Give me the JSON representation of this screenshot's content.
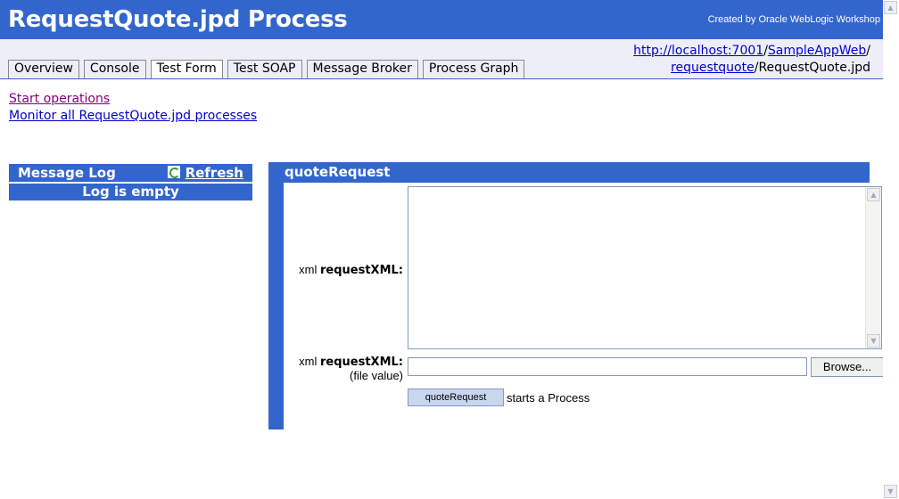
{
  "header": {
    "title": "RequestQuote.jpd Process",
    "created_by": "Created by Oracle WebLogic Workshop"
  },
  "tabs": [
    {
      "label": "Overview",
      "active": false
    },
    {
      "label": "Console",
      "active": false
    },
    {
      "label": "Test Form",
      "active": true
    },
    {
      "label": "Test SOAP",
      "active": false
    },
    {
      "label": "Message Broker",
      "active": false
    },
    {
      "label": "Process Graph",
      "active": false
    }
  ],
  "url": {
    "part1": "http://localhost:7001",
    "sep1": "/",
    "part2": "SampleAppWeb",
    "sep2": "/",
    "part3": "requestquote",
    "sep3": "/RequestQuote.jpd"
  },
  "links": {
    "start": "Start operations",
    "monitor": "Monitor all RequestQuote.jpd processes"
  },
  "message_log": {
    "title": "Message Log",
    "refresh": "Refresh",
    "empty": "Log is empty"
  },
  "operation": {
    "name": "quoteRequest",
    "field1_type": "xml",
    "field1_name": "requestXML:",
    "field1_value": "",
    "field2_type": "xml",
    "field2_name": "requestXML:",
    "field2_note": "(file value)",
    "browse_label": "Browse...",
    "submit_label": "quoteRequest",
    "submit_note": "starts a Process"
  },
  "colors": {
    "brand": "#3366cc",
    "tabbar_bg": "#eeeef8",
    "link": "#0000cc",
    "visited_link": "#800080"
  }
}
